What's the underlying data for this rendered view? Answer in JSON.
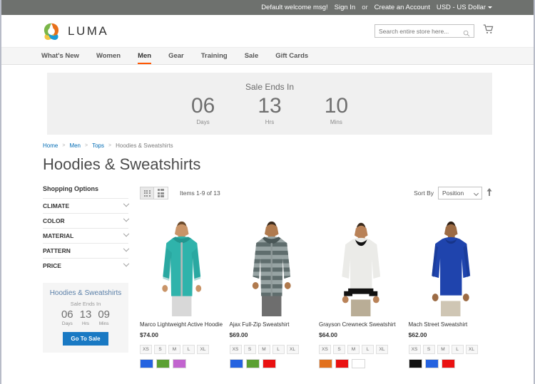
{
  "top_panel": {
    "welcome": "Default welcome msg!",
    "sign_in": "Sign In",
    "or": "or",
    "create_account": "Create an Account",
    "currency": "USD - US Dollar"
  },
  "header": {
    "logo_text": "LUMA",
    "search_placeholder": "Search entire store here...",
    "cart_icon": "cart-icon",
    "search_icon": "search-icon"
  },
  "nav": {
    "items": [
      {
        "label": "What's New",
        "active": false
      },
      {
        "label": "Women",
        "active": false
      },
      {
        "label": "Men",
        "active": true
      },
      {
        "label": "Gear",
        "active": false
      },
      {
        "label": "Training",
        "active": false
      },
      {
        "label": "Sale",
        "active": false
      },
      {
        "label": "Gift Cards",
        "active": false
      }
    ],
    "active_color": "#ff5501"
  },
  "banner": {
    "title": "Sale Ends In",
    "units": [
      {
        "value": "06",
        "label": "Days"
      },
      {
        "value": "13",
        "label": "Hrs"
      },
      {
        "value": "10",
        "label": "Mins"
      }
    ]
  },
  "breadcrumbs": {
    "items": [
      "Home",
      "Men",
      "Tops"
    ],
    "current": "Hoodies & Sweatshirts",
    "separator": ">"
  },
  "page_title": "Hoodies & Sweatshirts",
  "sidebar": {
    "title": "Shopping Options",
    "filters": [
      {
        "label": "CLIMATE"
      },
      {
        "label": "COLOR"
      },
      {
        "label": "MATERIAL"
      },
      {
        "label": "PATTERN"
      },
      {
        "label": "PRICE"
      }
    ],
    "promo": {
      "title": "Hoodies & Sweatshirts",
      "subtitle": "Sale Ends In",
      "units": [
        {
          "value": "06",
          "label": "Days"
        },
        {
          "value": "13",
          "label": "Hrs"
        },
        {
          "value": "09",
          "label": "Mins"
        }
      ],
      "button": "Go To Sale",
      "button_color": "#1979c3"
    }
  },
  "toolbar": {
    "grid_icon": "grid-view-icon",
    "list_icon": "list-view-icon",
    "count": "Items 1-9 of 13",
    "sort_label": "Sort By",
    "sort_value": "Position",
    "sort_direction_icon": "arrow-up-icon"
  },
  "products": [
    {
      "name": "Marco Lightweight Active Hoodie",
      "price": "$74.00",
      "sizes": [
        "XS",
        "S",
        "M",
        "L",
        "XL"
      ],
      "colors": [
        "#2563e0",
        "#5ba032",
        "#c264cf"
      ],
      "garment_color": "#2fb3ab",
      "garment_shade": "#23968f",
      "pants_color": "#d8d8d8",
      "skin": "#c99468",
      "skin_dark": "#ab7a51",
      "style": "zip-hoodie"
    },
    {
      "name": "Ajax Full-Zip Sweatshirt",
      "price": "$69.00",
      "sizes": [
        "XS",
        "S",
        "M",
        "L",
        "XL"
      ],
      "colors": [
        "#2563e0",
        "#5ba032",
        "#ea1111"
      ],
      "garment_color": "#97a3a3",
      "garment_shade": "#5f6d6d",
      "pants_color": "#6e6e6e",
      "skin": "#b07a4e",
      "skin_dark": "#8e6039",
      "style": "striped-zip-hoodie"
    },
    {
      "name": "Grayson Crewneck Sweatshirt",
      "price": "$64.00",
      "sizes": [
        "XS",
        "S",
        "M",
        "L",
        "XL"
      ],
      "colors": [
        "#e2711d",
        "#ea1111",
        "#ffffff"
      ],
      "garment_color": "#ebebe8",
      "garment_shade": "#111111",
      "pants_color": "#b9ad96",
      "skin": "#b98258",
      "skin_dark": "#97653f",
      "style": "crewneck"
    },
    {
      "name": "Mach Street Sweatshirt",
      "price": "$62.00",
      "sizes": [
        "XS",
        "S",
        "M",
        "L",
        "XL"
      ],
      "colors": [
        "#111111",
        "#2563e0",
        "#ea1111"
      ],
      "garment_color": "#1f44ad",
      "garment_shade": "#17358a",
      "pants_color": "#cfc6b4",
      "skin": "#9c6b44",
      "skin_dark": "#7d5333",
      "style": "crewneck"
    }
  ]
}
